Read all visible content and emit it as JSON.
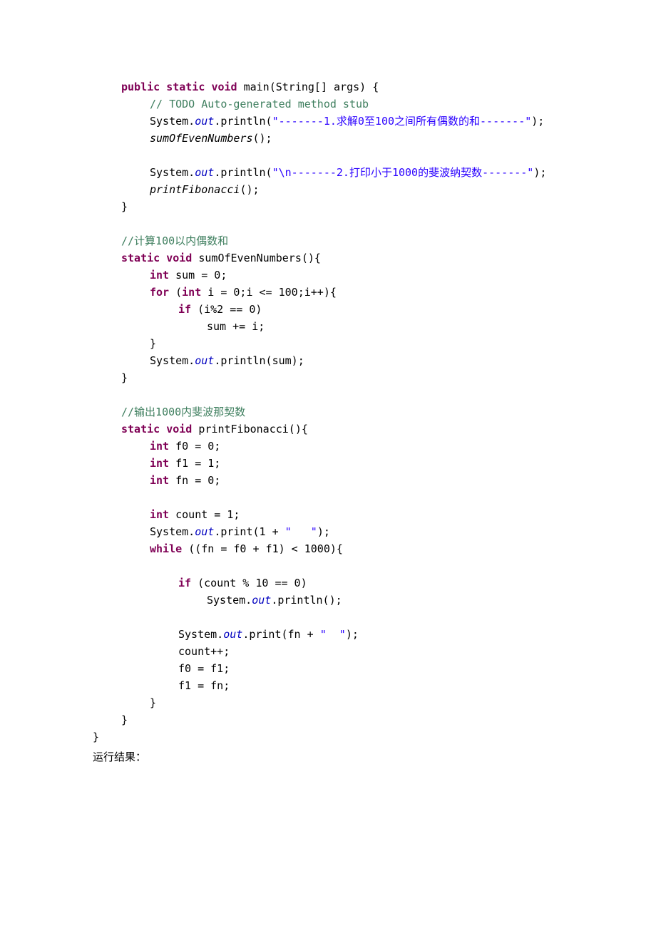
{
  "code": {
    "l1_public": "public ",
    "l1_static": "static ",
    "l1_void": "void",
    "l1_text": " main(String[] args) {",
    "l2_comment": "// TODO Auto-generated method stub",
    "l3_a": "System.",
    "l3_out": "out",
    "l3_b": ".println(",
    "l3_str": "\"-------1.求解0至100之间所有偶数的和-------\"",
    "l3_c": ");",
    "l4_call": "sumOfEvenNumbers",
    "l4_text": "();",
    "l5_a": "System.",
    "l5_out": "out",
    "l5_b": ".println(",
    "l5_str": "\"\\n-------2.打印小于1000的斐波纳契数-------\"",
    "l5_c": ");",
    "l6_call": "printFibonacci",
    "l6_text": "();",
    "brace_close": "}",
    "c1": "//计算100以内偶数和",
    "m1_static": "static ",
    "m1_void": "void",
    "m1_text": " sumOfEvenNumbers(){",
    "m2_int": "int",
    "m2_text": " sum = 0;",
    "m3_for": "for ",
    "m3_a": "(",
    "m3_int": "int",
    "m3_b": " i = 0;i <= 100;i++){",
    "m4_if": "if ",
    "m4_text": "(i%2 == 0)",
    "m5_text": "sum += i;",
    "m6_a": "System.",
    "m6_out": "out",
    "m6_b": ".println(sum);",
    "c2": "//输出1000内斐波那契数",
    "n1_static": "static ",
    "n1_void": "void",
    "n1_text": " printFibonacci(){",
    "n2_int": "int",
    "n2_text": " f0 = 0;",
    "n3_int": "int",
    "n3_text": " f1 = 1;",
    "n4_int": "int",
    "n4_text": " fn = 0;",
    "n5_int": "int",
    "n5_text": " count = 1;",
    "n6_a": "System.",
    "n6_out": "out",
    "n6_b": ".print(1 + ",
    "n6_str": "\"   \"",
    "n6_c": ");",
    "n7_while": "while ",
    "n7_text": "((fn = f0 + f1) < 1000){",
    "n8_if": "if ",
    "n8_text": "(count % 10 == 0)",
    "n9_a": "System.",
    "n9_out": "out",
    "n9_b": ".println();",
    "n10_a": "System.",
    "n10_out": "out",
    "n10_b": ".print(fn + ",
    "n10_str": "\"  \"",
    "n10_c": ");",
    "n11_text": "count++;",
    "n12_text": "f0 = f1;",
    "n13_text": "f1 = fn;"
  },
  "footer": "运行结果："
}
